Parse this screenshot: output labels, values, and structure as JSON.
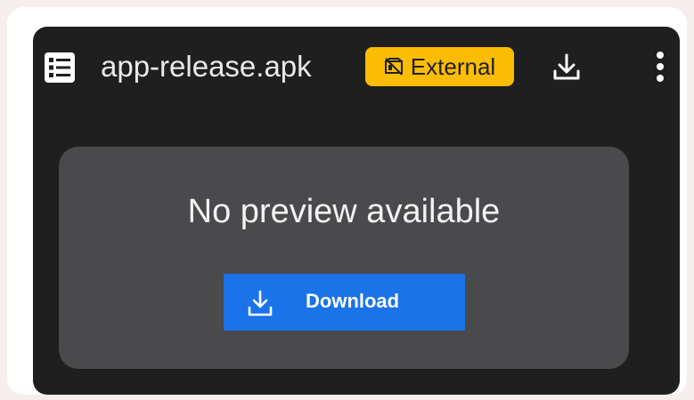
{
  "header": {
    "file_name": "app-release.apk",
    "badge_label": "External",
    "badge_color": "#fbbc04",
    "icons": {
      "file_type": "document-list-icon",
      "badge": "external-drive-icon",
      "download": "download-icon",
      "menu": "more-vert-icon"
    }
  },
  "preview": {
    "message": "No preview available",
    "download_button": {
      "label": "Download",
      "color": "#1a73e8",
      "icon": "download-icon"
    }
  },
  "colors": {
    "panel_bg": "#1f1f1f",
    "card_bg": "#4a494b",
    "page_bg": "#f6eded"
  }
}
